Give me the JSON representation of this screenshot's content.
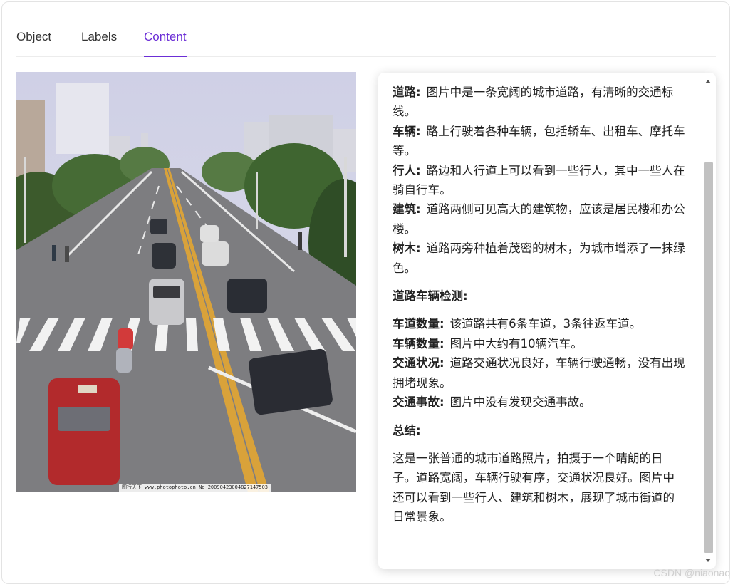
{
  "tabs": [
    {
      "label": "Object",
      "active": false
    },
    {
      "label": "Labels",
      "active": false
    },
    {
      "label": "Content",
      "active": true
    }
  ],
  "accent_color": "#6b2ed6",
  "image": {
    "caption": "图行天下 www.photophoto.cn No 20090423004827147503"
  },
  "content": {
    "road": {
      "term": "道路:",
      "text": "图片中是一条宽阔的城市道路，有清晰的交通标线。"
    },
    "vehicles": {
      "term": "车辆:",
      "text": "路上行驶着各种车辆，包括轿车、出租车、摩托车等。"
    },
    "pedestrians": {
      "term": "行人:",
      "text": "路边和人行道上可以看到一些行人，其中一些人在骑自行车。"
    },
    "buildings": {
      "term": "建筑:",
      "text": "道路两侧可见高大的建筑物，应该是居民楼和办公楼。"
    },
    "trees": {
      "term": "树木:",
      "text": "道路两旁种植着茂密的树木，为城市增添了一抹绿色。"
    },
    "detection_heading": "道路车辆检测:",
    "lanes": {
      "term": "车道数量:",
      "text": "该道路共有6条车道，3条往返车道。"
    },
    "vehicle_count": {
      "term": "车辆数量:",
      "text": "图片中大约有10辆汽车。"
    },
    "traffic": {
      "term": "交通状况:",
      "text": "道路交通状况良好，车辆行驶通畅，没有出现拥堵现象。"
    },
    "accidents": {
      "term": "交通事故:",
      "text": "图片中没有发现交通事故。"
    },
    "summary_heading": "总结:",
    "summary": "这是一张普通的城市道路照片，拍摄于一个晴朗的日子。道路宽阔，车辆行驶有序，交通状况良好。图片中还可以看到一些行人、建筑和树木，展现了城市街道的日常景象。"
  },
  "watermark": "CSDN @niaonao"
}
